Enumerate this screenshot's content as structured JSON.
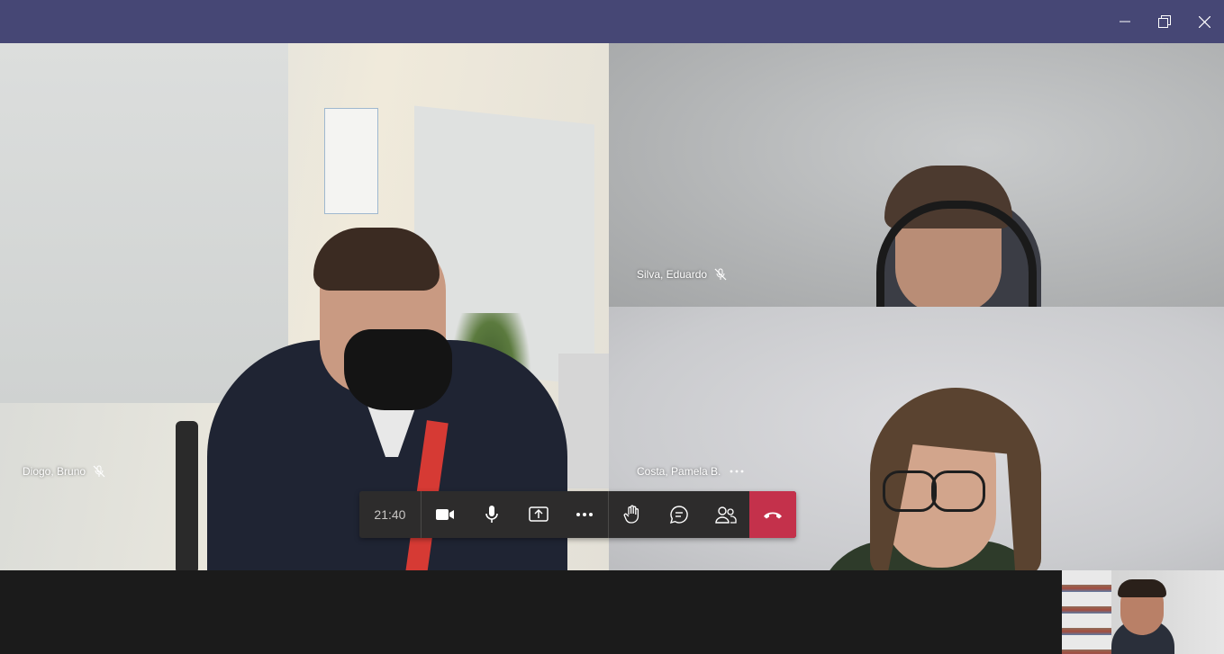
{
  "window": {
    "controls": [
      {
        "name": "minimize-icon"
      },
      {
        "name": "restore-icon"
      },
      {
        "name": "close-icon"
      }
    ]
  },
  "participants": [
    {
      "name": "Diogo, Bruno",
      "muted": true,
      "more_menu": false
    },
    {
      "name": "Silva, Eduardo",
      "muted": true,
      "more_menu": false
    },
    {
      "name": "Costa, Pamela B.",
      "muted": false,
      "more_menu": true
    }
  ],
  "toolbar": {
    "timer": "21:40",
    "buttons": [
      "camera-icon",
      "microphone-icon",
      "share-screen-icon",
      "more-options-icon",
      "raise-hand-icon",
      "chat-icon",
      "participants-icon",
      "hang-up-icon"
    ],
    "hangup_color": "#c4314b"
  },
  "colors": {
    "titlebar": "#464775",
    "stage_background": "#1b1b1b",
    "toolbar_background": "#2d2c2c"
  }
}
